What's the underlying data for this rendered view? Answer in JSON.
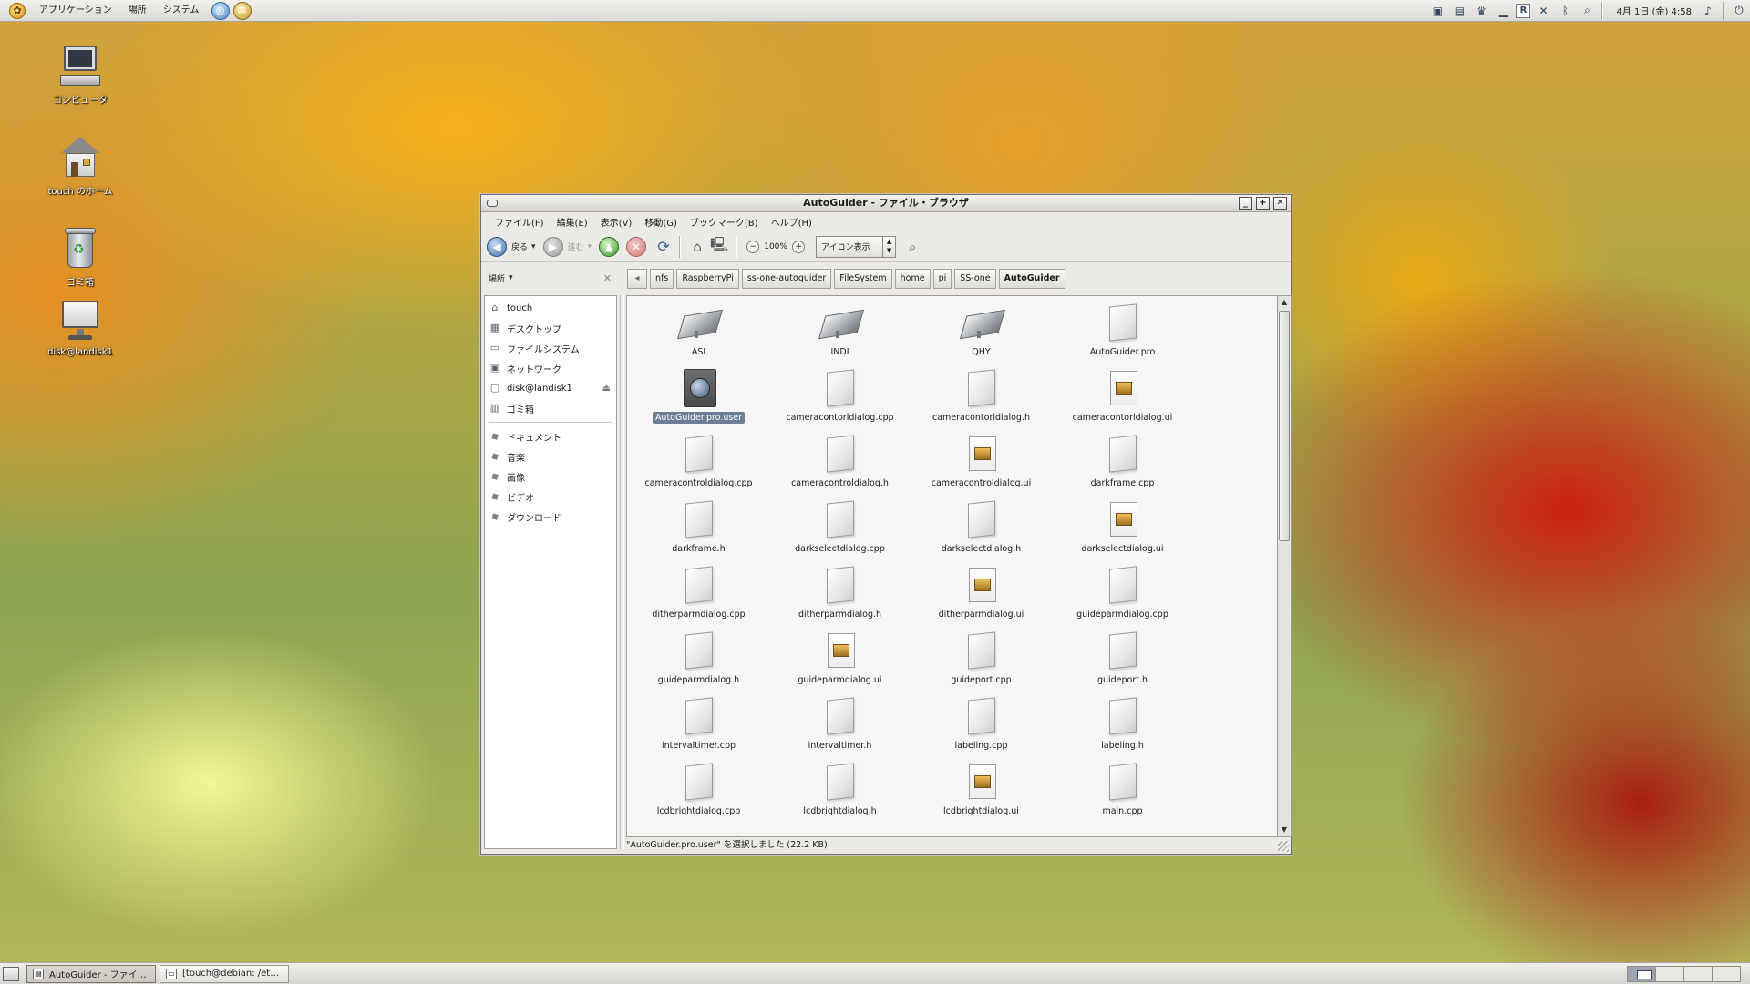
{
  "top_panel": {
    "menus": [
      "アプリケーション",
      "場所",
      "システム"
    ],
    "clock": "4月 1日 (金)  4:58"
  },
  "desktop_icons": [
    {
      "label": "コンピュータ"
    },
    {
      "label": "touch のホーム"
    },
    {
      "label": "ゴミ箱"
    },
    {
      "label": "disk@landisk1"
    }
  ],
  "window": {
    "title": "AutoGuider - ファイル・ブラウザ",
    "menubar": [
      "ファイル(F)",
      "編集(E)",
      "表示(V)",
      "移動(G)",
      "ブックマーク(B)",
      "ヘルプ(H)"
    ],
    "toolbar": {
      "back_label": "戻る",
      "forward_label": "進む",
      "zoom": "100%",
      "view_mode": "アイコン表示"
    },
    "sidebar": {
      "header": "場所",
      "places": [
        {
          "label": "touch",
          "icon": "home-icon"
        },
        {
          "label": "デスクトップ",
          "icon": "desktop-icon"
        },
        {
          "label": "ファイルシステム",
          "icon": "drive-icon"
        },
        {
          "label": "ネットワーク",
          "icon": "network-icon"
        },
        {
          "label": "disk@landisk1",
          "icon": "network-drive-icon"
        },
        {
          "label": "ゴミ箱",
          "icon": "trash-icon"
        }
      ],
      "bookmarks": [
        "ドキュメント",
        "音楽",
        "画像",
        "ビデオ",
        "ダウンロード"
      ]
    },
    "pathbar": [
      "nfs",
      "RaspberryPi",
      "ss-one-autoguider",
      "FileSystem",
      "home",
      "pi",
      "SS-one",
      "AutoGuider"
    ],
    "files": [
      {
        "name": "ASI",
        "type": "dir"
      },
      {
        "name": "INDI",
        "type": "dir"
      },
      {
        "name": "QHY",
        "type": "dir"
      },
      {
        "name": "AutoGuider.pro",
        "type": "doc"
      },
      {
        "name": "AutoGuider.pro.user",
        "type": "user",
        "selected": true
      },
      {
        "name": "cameracontorldialog.cpp",
        "type": "doc"
      },
      {
        "name": "cameracontorldialog.h",
        "type": "doc"
      },
      {
        "name": "cameracontorldialog.ui",
        "type": "ui"
      },
      {
        "name": "cameracontroldialog.cpp",
        "type": "doc"
      },
      {
        "name": "cameracontroldialog.h",
        "type": "doc"
      },
      {
        "name": "cameracontroldialog.ui",
        "type": "ui"
      },
      {
        "name": "darkframe.cpp",
        "type": "doc"
      },
      {
        "name": "darkframe.h",
        "type": "doc"
      },
      {
        "name": "darkselectdialog.cpp",
        "type": "doc"
      },
      {
        "name": "darkselectdialog.h",
        "type": "doc"
      },
      {
        "name": "darkselectdialog.ui",
        "type": "ui"
      },
      {
        "name": "ditherparmdialog.cpp",
        "type": "doc"
      },
      {
        "name": "ditherparmdialog.h",
        "type": "doc"
      },
      {
        "name": "ditherparmdialog.ui",
        "type": "ui"
      },
      {
        "name": "guideparmdialog.cpp",
        "type": "doc"
      },
      {
        "name": "guideparmdialog.h",
        "type": "doc"
      },
      {
        "name": "guideparmdialog.ui",
        "type": "ui"
      },
      {
        "name": "guideport.cpp",
        "type": "doc"
      },
      {
        "name": "guideport.h",
        "type": "doc"
      },
      {
        "name": "intervaltimer.cpp",
        "type": "doc"
      },
      {
        "name": "intervaltimer.h",
        "type": "doc"
      },
      {
        "name": "labeling.cpp",
        "type": "doc"
      },
      {
        "name": "labeling.h",
        "type": "doc"
      },
      {
        "name": "lcdbrightdialog.cpp",
        "type": "doc"
      },
      {
        "name": "lcdbrightdialog.h",
        "type": "doc"
      },
      {
        "name": "lcdbrightdialog.ui",
        "type": "ui"
      },
      {
        "name": "main.cpp",
        "type": "doc"
      }
    ],
    "status": "\"AutoGuider.pro.user\" を選択しました (22.2 KB)"
  },
  "taskbar": [
    {
      "label": "AutoGuider - ファイ…",
      "active": true
    },
    {
      "label": "[touch@debian: /et…",
      "active": false
    }
  ]
}
